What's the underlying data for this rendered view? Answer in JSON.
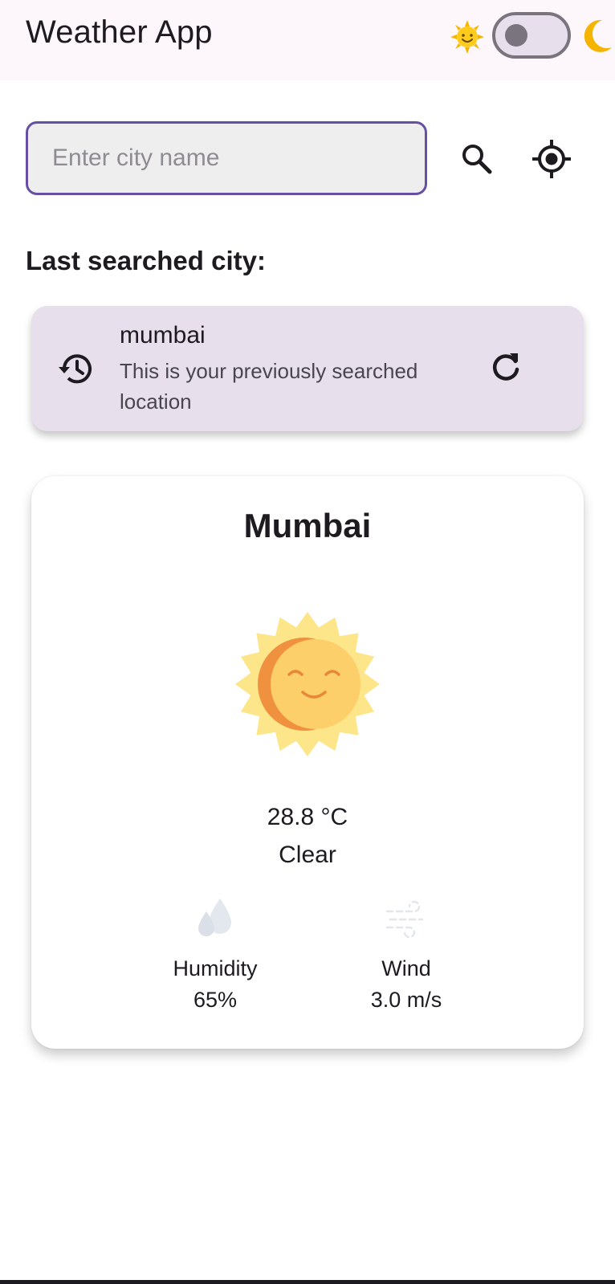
{
  "appbar": {
    "title": "Weather App",
    "theme_toggle": {
      "light_icon": "sun-emoji-icon",
      "dark_icon": "crescent-moon-icon",
      "is_dark": false
    }
  },
  "search": {
    "placeholder": "Enter city name",
    "value": "",
    "search_icon": "search-icon",
    "location_icon": "my-location-icon"
  },
  "history": {
    "section_label": "Last searched city:",
    "city": "mumbai",
    "subtitle": "This is your previously searched location",
    "leading_icon": "history-icon",
    "trailing_icon": "refresh-icon"
  },
  "weather": {
    "city": "Mumbai",
    "temperature": "28.8 °C",
    "condition": "Clear",
    "condition_icon": "smiling-sun-icon",
    "humidity": {
      "label": "Humidity",
      "value": "65%",
      "icon": "humidity-drops-icon"
    },
    "wind": {
      "label": "Wind",
      "value": "3.0 m/s",
      "icon": "wind-icon"
    }
  },
  "colors": {
    "primary": "#6750a4",
    "appbar_bg": "#fdf7fc",
    "history_card_bg": "#e7e0ec",
    "search_field_bg": "#eeeeee",
    "text": "#1d1b20"
  }
}
